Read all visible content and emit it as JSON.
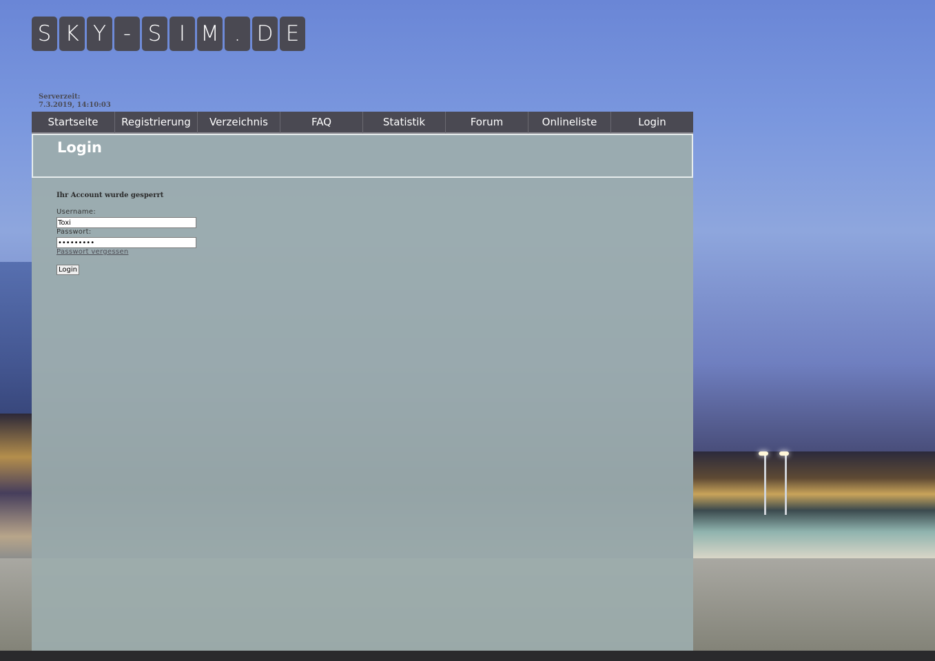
{
  "logo": {
    "tiles": [
      "S",
      "K",
      "Y",
      "-",
      "S",
      "I",
      "M",
      ".",
      "D",
      "E"
    ]
  },
  "serverzeit": {
    "label": "Serverzeit:",
    "value": "7.3.2019, 14:10:03"
  },
  "nav": {
    "items": [
      "Startseite",
      "Registrierung",
      "Verzeichnis",
      "FAQ",
      "Statistik",
      "Forum",
      "Onlineliste",
      "Login"
    ]
  },
  "panel": {
    "title": "Login",
    "message": "Ihr Account wurde gesperrt",
    "username_label": "Username:",
    "username_value": "Toxi",
    "password_label": "Passwort:",
    "password_value": "xxxxxxxxx",
    "forgot_label": "Passwort vergessen",
    "login_button": "Login"
  },
  "colors": {
    "nav_bg": "#4a4952",
    "panel_bg": "#9cacac",
    "logo_tile": "#4a4952"
  }
}
